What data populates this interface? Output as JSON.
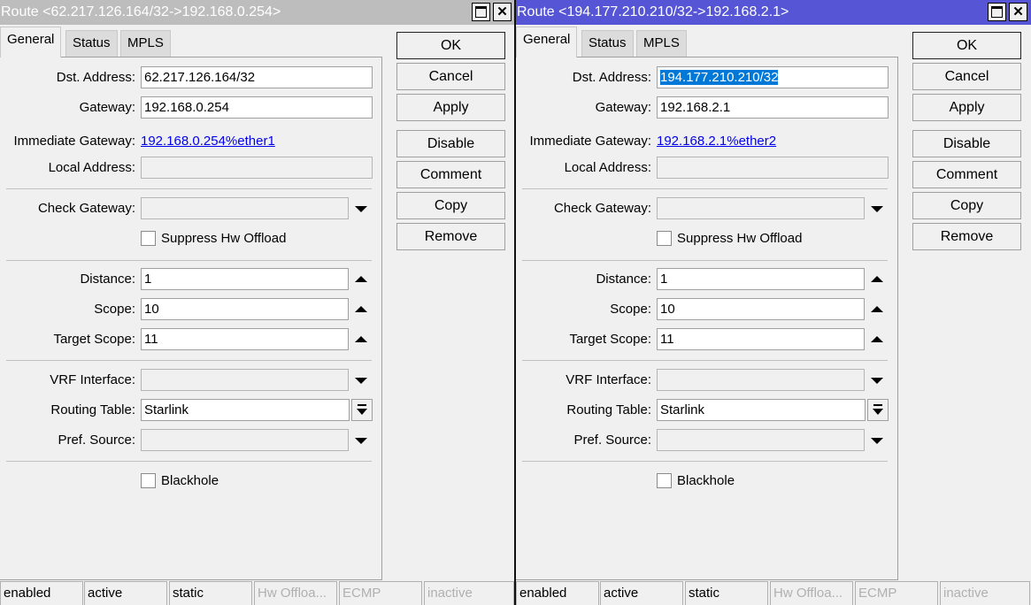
{
  "windows": [
    {
      "title": "Route <62.217.126.164/32->192.168.0.254>",
      "active": false,
      "tabs": [
        "General",
        "Status",
        "MPLS"
      ],
      "selected_tab": 0,
      "fields": {
        "dst_address": {
          "label": "Dst. Address:",
          "value": "62.217.126.164/32",
          "selected": false
        },
        "gateway": {
          "label": "Gateway:",
          "value": "192.168.0.254"
        },
        "immediate_gateway": {
          "label": "Immediate Gateway:",
          "value": "192.168.0.254%ether1"
        },
        "local_address": {
          "label": "Local Address:",
          "value": ""
        },
        "check_gateway": {
          "label": "Check Gateway:",
          "value": ""
        },
        "suppress_hw_offload": {
          "label": "Suppress Hw Offload",
          "checked": false
        },
        "distance": {
          "label": "Distance:",
          "value": "1"
        },
        "scope": {
          "label": "Scope:",
          "value": "10"
        },
        "target_scope": {
          "label": "Target Scope:",
          "value": "11"
        },
        "vrf_interface": {
          "label": "VRF Interface:",
          "value": ""
        },
        "routing_table": {
          "label": "Routing Table:",
          "value": "Starlink"
        },
        "pref_source": {
          "label": "Pref. Source:",
          "value": ""
        },
        "blackhole": {
          "label": "Blackhole",
          "checked": false
        }
      },
      "buttons": [
        "OK",
        "Cancel",
        "Apply",
        "Disable",
        "Comment",
        "Copy",
        "Remove"
      ],
      "status_bar": [
        "enabled",
        "active",
        "static",
        "Hw Offloa...",
        "ECMP",
        "inactive"
      ]
    },
    {
      "title": "Route <194.177.210.210/32->192.168.2.1>",
      "active": true,
      "tabs": [
        "General",
        "Status",
        "MPLS"
      ],
      "selected_tab": 0,
      "fields": {
        "dst_address": {
          "label": "Dst. Address:",
          "value": "194.177.210.210/32",
          "selected": true
        },
        "gateway": {
          "label": "Gateway:",
          "value": "192.168.2.1"
        },
        "immediate_gateway": {
          "label": "Immediate Gateway:",
          "value": "192.168.2.1%ether2"
        },
        "local_address": {
          "label": "Local Address:",
          "value": ""
        },
        "check_gateway": {
          "label": "Check Gateway:",
          "value": ""
        },
        "suppress_hw_offload": {
          "label": "Suppress Hw Offload",
          "checked": false
        },
        "distance": {
          "label": "Distance:",
          "value": "1"
        },
        "scope": {
          "label": "Scope:",
          "value": "10"
        },
        "target_scope": {
          "label": "Target Scope:",
          "value": "11"
        },
        "vrf_interface": {
          "label": "VRF Interface:",
          "value": ""
        },
        "routing_table": {
          "label": "Routing Table:",
          "value": "Starlink"
        },
        "pref_source": {
          "label": "Pref. Source:",
          "value": ""
        },
        "blackhole": {
          "label": "Blackhole",
          "checked": false
        }
      },
      "buttons": [
        "OK",
        "Cancel",
        "Apply",
        "Disable",
        "Comment",
        "Copy",
        "Remove"
      ],
      "status_bar": [
        "enabled",
        "active",
        "static",
        "Hw Offloa...",
        "ECMP",
        "inactive"
      ]
    }
  ]
}
